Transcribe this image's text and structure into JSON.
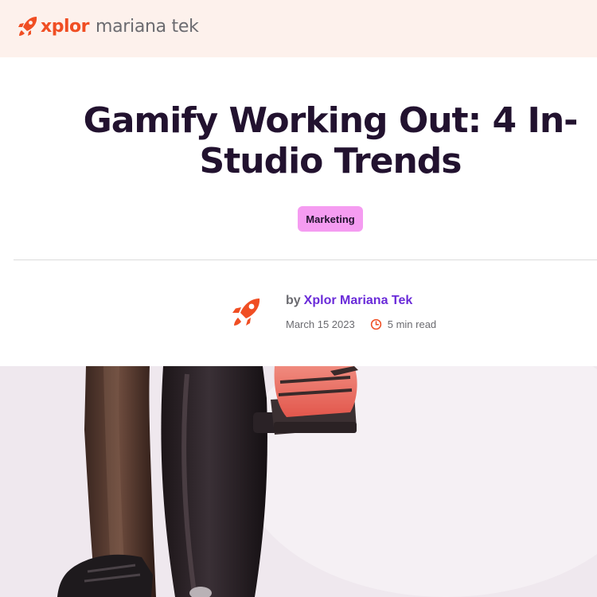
{
  "header": {
    "brand": "xplor",
    "product": "mariana tek",
    "logo_color": "#f04e23",
    "background": "#fdf1ec"
  },
  "article": {
    "title": "Gamify Working Out: 4 In-Studio Trends",
    "category": "Marketing",
    "category_color": "#f59cf1",
    "by_label": "by",
    "author": "Xplor Mariana Tek",
    "author_color": "#6a2bd9",
    "date": "March 15 2023",
    "read_time": "5 min read",
    "icons": {
      "avatar": "rocket-icon",
      "read_time": "clock-icon"
    }
  },
  "hero": {
    "description_icon": "hero-image"
  }
}
